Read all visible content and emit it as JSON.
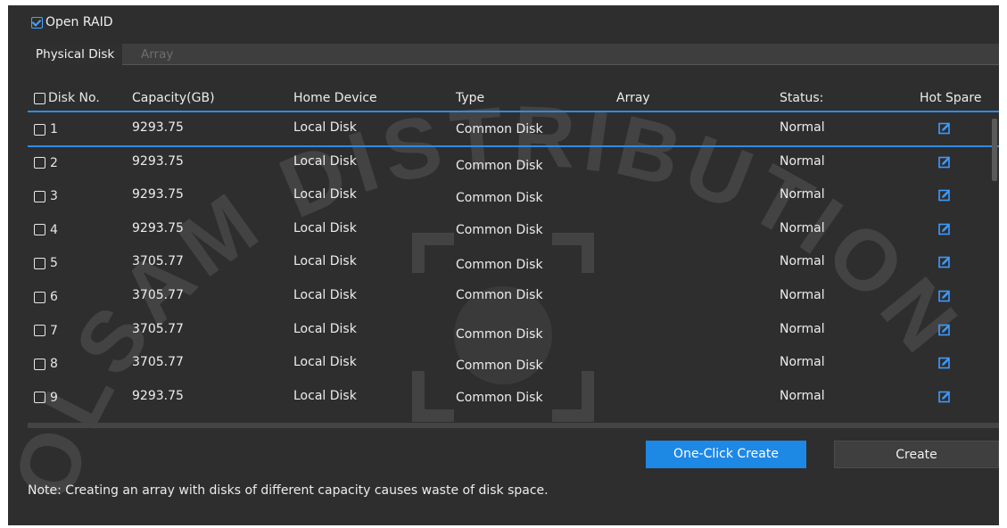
{
  "raid": {
    "label": "Open RAID",
    "checked": true
  },
  "tabs": [
    {
      "label": "Physical Disk",
      "active": true
    },
    {
      "label": "Array",
      "active": false
    }
  ],
  "table": {
    "headers": {
      "disk_no": "Disk No.",
      "capacity": "Capacity(GB)",
      "home_device": "Home Device",
      "type": "Type",
      "array": "Array",
      "status": "Status:",
      "hot_spare": "Hot Spare"
    },
    "rows": [
      {
        "no": "1",
        "capacity": "9293.75",
        "home": "Local Disk",
        "type": "Common Disk",
        "array": "",
        "status": "Normal",
        "hot_spare_icon": "edit-icon"
      },
      {
        "no": "2",
        "capacity": "9293.75",
        "home": "Local Disk",
        "type": "Common Disk",
        "array": "",
        "status": "Normal",
        "hot_spare_icon": "edit-icon"
      },
      {
        "no": "3",
        "capacity": "9293.75",
        "home": "Local Disk",
        "type": "Common Disk",
        "array": "",
        "status": "Normal",
        "hot_spare_icon": "edit-icon"
      },
      {
        "no": "4",
        "capacity": "9293.75",
        "home": "Local Disk",
        "type": "Common Disk",
        "array": "",
        "status": "Normal",
        "hot_spare_icon": "edit-icon"
      },
      {
        "no": "5",
        "capacity": "3705.77",
        "home": "Local Disk",
        "type": "Common Disk",
        "array": "",
        "status": "Normal",
        "hot_spare_icon": "edit-icon"
      },
      {
        "no": "6",
        "capacity": "3705.77",
        "home": "Local Disk",
        "type": "Common Disk",
        "array": "",
        "status": "Normal",
        "hot_spare_icon": "edit-icon"
      },
      {
        "no": "7",
        "capacity": "3705.77",
        "home": "Local Disk",
        "type": "Common Disk",
        "array": "",
        "status": "Normal",
        "hot_spare_icon": "edit-icon"
      },
      {
        "no": "8",
        "capacity": "3705.77",
        "home": "Local Disk",
        "type": "Common Disk",
        "array": "",
        "status": "Normal",
        "hot_spare_icon": "edit-icon"
      },
      {
        "no": "9",
        "capacity": "9293.75",
        "home": "Local Disk",
        "type": "Common Disk",
        "array": "",
        "status": "Normal",
        "hot_spare_icon": "edit-icon"
      }
    ]
  },
  "buttons": {
    "one_click": "One-Click Create",
    "create": "Create"
  },
  "note": "Note: Creating an array with disks of different capacity causes waste of disk space.",
  "watermark": {
    "text": "OLSAM DISTRIBUTION"
  },
  "colors": {
    "accent": "#1e88e5",
    "background": "#2e2e2e",
    "selection_line": "#2f8be6"
  }
}
